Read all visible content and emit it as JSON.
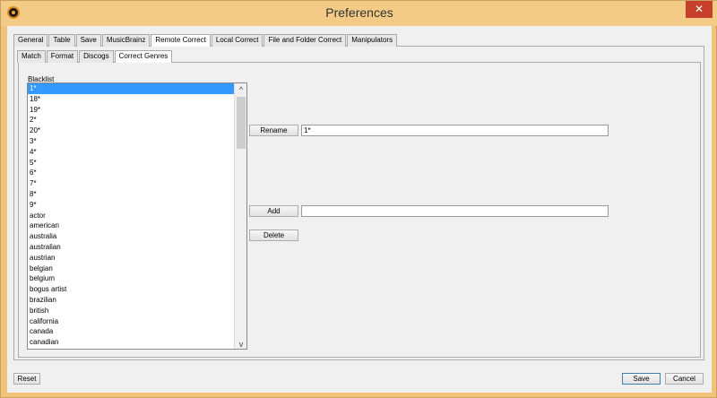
{
  "window": {
    "title": "Preferences",
    "close_glyph": "✕"
  },
  "tabs": [
    "General",
    "Table",
    "Save",
    "MusicBrainz",
    "Remote Correct",
    "Local Correct",
    "File and Folder Correct",
    "Manipulators"
  ],
  "subtabs": [
    "Match",
    "Format",
    "Discogs",
    "Correct Genres"
  ],
  "blacklist": {
    "label": "Blacklist",
    "items": [
      "1*",
      "18*",
      "19*",
      "2*",
      "20*",
      "3*",
      "4*",
      "5*",
      "6*",
      "7*",
      "8*",
      "9*",
      "actor",
      "american",
      "australia",
      "australian",
      "austrian",
      "belgian",
      "belgium",
      "bogus artist",
      "brazilian",
      "british",
      "california",
      "canada",
      "canadian"
    ]
  },
  "actions": {
    "rename_label": "Rename",
    "rename_value": "1*",
    "add_label": "Add",
    "add_value": "",
    "delete_label": "Delete"
  },
  "footer": {
    "reset_label": "Reset",
    "save_label": "Save",
    "cancel_label": "Cancel"
  },
  "scroll": {
    "up_glyph": "^",
    "down_glyph": "v"
  }
}
